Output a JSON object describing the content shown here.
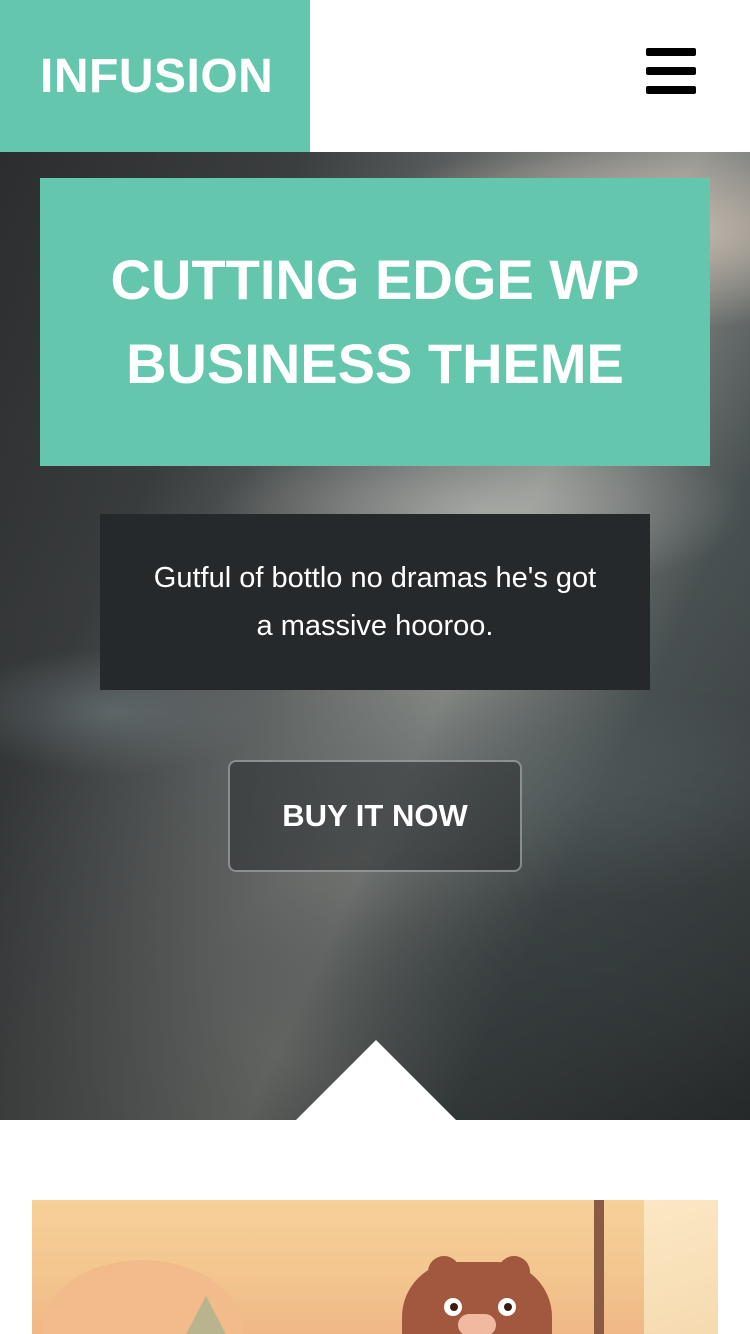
{
  "header": {
    "logo": "INFUSION",
    "menu_icon": "hamburger-menu-icon"
  },
  "hero": {
    "headline": "CUTTING EDGE WP BUSINESS THEME",
    "subtitle": "Gutful of bottlo no dramas he's got a massive hooroo.",
    "cta_label": "BUY IT NOW"
  },
  "colors": {
    "accent": "#63c6ad",
    "dark_box": "#26292b",
    "white": "#ffffff"
  },
  "feature": {
    "image_subject": "illustrated-bear-scene"
  }
}
